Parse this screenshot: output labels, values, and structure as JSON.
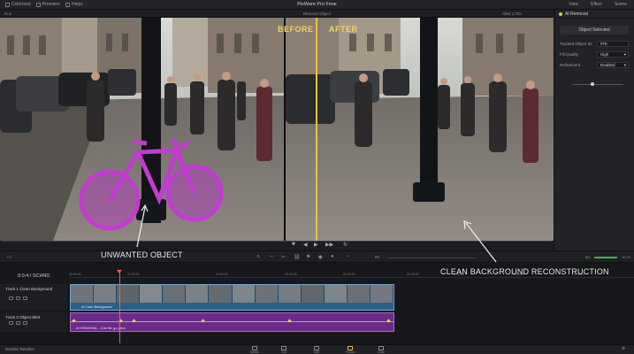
{
  "window": {
    "title": "PixWare Pro Fxne"
  },
  "menu": {
    "tabs": [
      "Colorboot",
      "Premiere",
      "Helps"
    ],
    "right_tabs": [
      "View",
      "Effect",
      "Scene"
    ]
  },
  "viewer": {
    "left_label": "Run",
    "center_label": "Remove Object",
    "right_label": "After 1:Tim",
    "before_label": "BEFORE",
    "after_label": "AFTER"
  },
  "inspector": {
    "title": "AI Removal",
    "object_selected": "Object Selected",
    "props": [
      {
        "label": "Tracked Object ID",
        "value": "#76"
      },
      {
        "label": "Fill Quality",
        "value": "High"
      },
      {
        "label": "Refinement",
        "value": "Enabled"
      }
    ]
  },
  "toolbar": {
    "zoom_value": "80",
    "audio_level_label": "AC",
    "timecode_right": "10:75"
  },
  "timeline": {
    "timecode": "0:0:4:/ SCHND",
    "ruler_marks": [
      "00:00:00",
      "01:00:00",
      "00:00:00",
      "00:00:00",
      "00:00:00",
      "00:00:00",
      "00:00:00",
      "00:00:00",
      "00:00:00"
    ],
    "tracks": [
      {
        "name": "Track 1   Clean Background",
        "clip_label": "AI Cam Backgound"
      },
      {
        "name": "Track 2   Object Mert",
        "clip_label": "AI REMOVAL  -  Chk file go prnd"
      }
    ]
  },
  "status": {
    "app_name": "DaVinci Resolve",
    "pages": [
      "Media",
      "Cut",
      "Edit",
      "Fusion",
      "Color"
    ]
  },
  "annotations": {
    "unwanted": "UNWANTED OBJECT",
    "clean": "CLEAN BACKGROUND RECONSTRUCTION"
  },
  "colors": {
    "before_after_accent": "#e9c63c",
    "overlay_magenta": "#c13ccf",
    "clip_blue": "#2a5f86",
    "clip_purple": "#6a2a87",
    "playhead": "#ff5a3c"
  }
}
